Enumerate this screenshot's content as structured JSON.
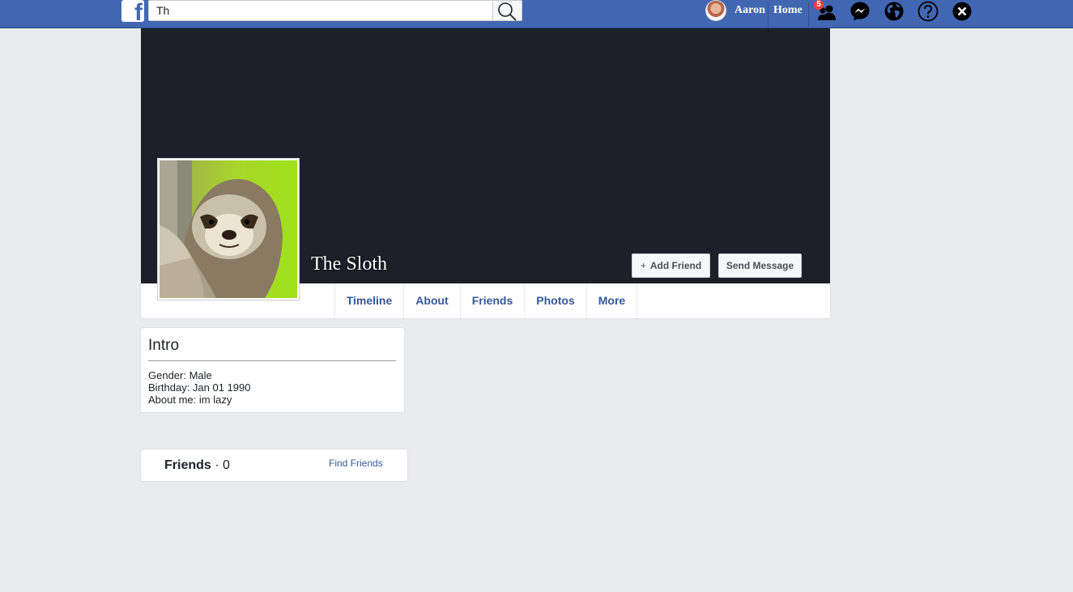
{
  "topbar": {
    "logo": "f",
    "search_value": "Th",
    "search_icon": "search-icon",
    "user_name": "Aaron",
    "home_label": "Home",
    "friend_requests_count": "5",
    "icons": [
      "friend-requests-icon",
      "messenger-icon",
      "notifications-globe-icon",
      "help-icon",
      "close-icon"
    ],
    "colors": {
      "bar": "#4267b2",
      "badge": "#fa3e3e"
    }
  },
  "profile": {
    "name": "The Sloth",
    "add_friend_label": "Add Friend",
    "add_friend_icon": "+",
    "send_message_label": "Send Message",
    "cover_color": "#1d1f29"
  },
  "tabs": [
    "Timeline",
    "About",
    "Friends",
    "Photos",
    "More"
  ],
  "intro": {
    "title": "Intro",
    "lines": [
      "Gender: Male",
      "Birthday: Jan 01 1990",
      "About me: im lazy"
    ]
  },
  "friends_card": {
    "title": "Friends",
    "separator": " · ",
    "count": "0",
    "find_friends_label": "Find Friends"
  }
}
